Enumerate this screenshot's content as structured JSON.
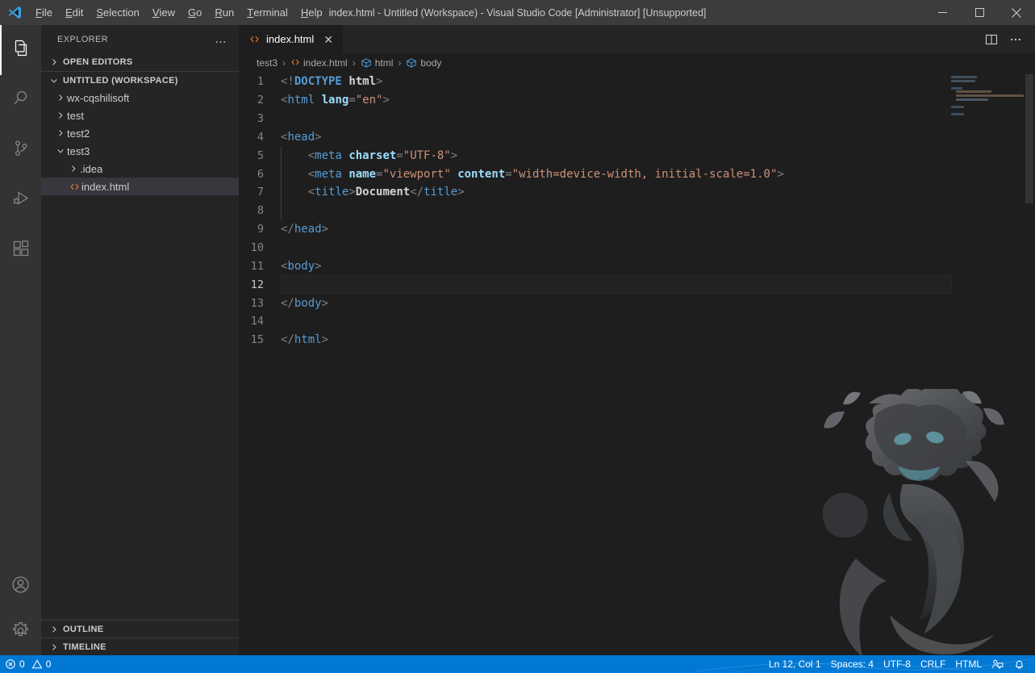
{
  "titlebar": {
    "window_title": "index.html - Untitled (Workspace) - Visual Studio Code [Administrator] [Unsupported]",
    "menus": [
      {
        "label": "File",
        "mnemonic": "F"
      },
      {
        "label": "Edit",
        "mnemonic": "E"
      },
      {
        "label": "Selection",
        "mnemonic": "S"
      },
      {
        "label": "View",
        "mnemonic": "V"
      },
      {
        "label": "Go",
        "mnemonic": "G"
      },
      {
        "label": "Run",
        "mnemonic": "R"
      },
      {
        "label": "Terminal",
        "mnemonic": "T"
      },
      {
        "label": "Help",
        "mnemonic": "H"
      }
    ],
    "window_controls": {
      "minimize": "minimize-icon",
      "maximize": "maximize-icon",
      "close": "close-icon"
    }
  },
  "activitybar": {
    "top_items": [
      {
        "name": "explorer",
        "icon": "files-icon",
        "active": true
      },
      {
        "name": "search",
        "icon": "search-icon",
        "active": false
      },
      {
        "name": "source-control",
        "icon": "source-control-icon",
        "active": false
      },
      {
        "name": "run-and-debug",
        "icon": "run-debug-icon",
        "active": false
      },
      {
        "name": "extensions",
        "icon": "extensions-icon",
        "active": false
      }
    ],
    "bottom_items": [
      {
        "name": "accounts",
        "icon": "account-icon"
      },
      {
        "name": "manage",
        "icon": "gear-icon"
      }
    ]
  },
  "sidebar": {
    "title": "EXPLORER",
    "more_actions": "…",
    "open_editors": {
      "label": "OPEN EDITORS",
      "expanded": false
    },
    "workspace": {
      "label": "UNTITLED (WORKSPACE)",
      "expanded": true
    },
    "tree": [
      {
        "label": "wx-cqshilisoft",
        "type": "folder",
        "depth": 1,
        "expanded": false,
        "selected": false
      },
      {
        "label": "test",
        "type": "folder",
        "depth": 1,
        "expanded": false,
        "selected": false
      },
      {
        "label": "test2",
        "type": "folder",
        "depth": 1,
        "expanded": false,
        "selected": false
      },
      {
        "label": "test3",
        "type": "folder",
        "depth": 1,
        "expanded": true,
        "selected": false
      },
      {
        "label": ".idea",
        "type": "folder",
        "depth": 2,
        "expanded": false,
        "selected": false
      },
      {
        "label": "index.html",
        "type": "html-file",
        "depth": 2,
        "expanded": false,
        "selected": true
      }
    ],
    "outline": {
      "label": "OUTLINE",
      "expanded": false
    },
    "timeline": {
      "label": "TIMELINE",
      "expanded": false
    }
  },
  "editor": {
    "tabs": [
      {
        "label": "index.html",
        "icon": "html-file-icon",
        "close": "✕",
        "active": true
      }
    ],
    "actions": [
      {
        "name": "split-editor",
        "icon": "split-editor-icon"
      },
      {
        "name": "more-actions",
        "icon": "ellipsis-icon"
      }
    ],
    "breadcrumbs": [
      {
        "label": "test3",
        "icon": ""
      },
      {
        "label": "index.html",
        "icon": "html-file-icon"
      },
      {
        "label": "html",
        "icon": "symbol-field-icon"
      },
      {
        "label": "body",
        "icon": "symbol-field-icon"
      }
    ],
    "breadcrumb_separator": "›",
    "lines": [
      {
        "n": "1",
        "tokens": [
          {
            "t": "punct",
            "v": "<!"
          },
          {
            "t": "doctype",
            "v": "DOCTYPE"
          },
          {
            "t": "text",
            "v": " "
          },
          {
            "t": "textb",
            "v": "html"
          },
          {
            "t": "punct",
            "v": ">"
          }
        ],
        "indent": 0,
        "active": false
      },
      {
        "n": "2",
        "tokens": [
          {
            "t": "punct",
            "v": "<"
          },
          {
            "t": "tag",
            "v": "html"
          },
          {
            "t": "text",
            "v": " "
          },
          {
            "t": "attr",
            "v": "lang"
          },
          {
            "t": "punct",
            "v": "="
          },
          {
            "t": "str",
            "v": "\"en\""
          },
          {
            "t": "punct",
            "v": ">"
          }
        ],
        "indent": 0,
        "active": false
      },
      {
        "n": "3",
        "tokens": [],
        "indent": 0,
        "active": false
      },
      {
        "n": "4",
        "tokens": [
          {
            "t": "punct",
            "v": "<"
          },
          {
            "t": "tag",
            "v": "head"
          },
          {
            "t": "punct",
            "v": ">"
          }
        ],
        "indent": 0,
        "active": false
      },
      {
        "n": "5",
        "tokens": [
          {
            "t": "text",
            "v": "    "
          },
          {
            "t": "punct",
            "v": "<"
          },
          {
            "t": "tag",
            "v": "meta"
          },
          {
            "t": "text",
            "v": " "
          },
          {
            "t": "attr",
            "v": "charset"
          },
          {
            "t": "punct",
            "v": "="
          },
          {
            "t": "str",
            "v": "\"UTF-8\""
          },
          {
            "t": "punct",
            "v": ">"
          }
        ],
        "indent": 1,
        "active": false
      },
      {
        "n": "6",
        "tokens": [
          {
            "t": "text",
            "v": "    "
          },
          {
            "t": "punct",
            "v": "<"
          },
          {
            "t": "tag",
            "v": "meta"
          },
          {
            "t": "text",
            "v": " "
          },
          {
            "t": "attr",
            "v": "name"
          },
          {
            "t": "punct",
            "v": "="
          },
          {
            "t": "str",
            "v": "\"viewport\""
          },
          {
            "t": "text",
            "v": " "
          },
          {
            "t": "attr",
            "v": "content"
          },
          {
            "t": "punct",
            "v": "="
          },
          {
            "t": "str",
            "v": "\"width=device-width, initial-scale=1.0\""
          },
          {
            "t": "punct",
            "v": ">"
          }
        ],
        "indent": 1,
        "active": false
      },
      {
        "n": "7",
        "tokens": [
          {
            "t": "text",
            "v": "    "
          },
          {
            "t": "punct",
            "v": "<"
          },
          {
            "t": "tag",
            "v": "title"
          },
          {
            "t": "punct",
            "v": ">"
          },
          {
            "t": "textb",
            "v": "Document"
          },
          {
            "t": "punct",
            "v": "</"
          },
          {
            "t": "tag",
            "v": "title"
          },
          {
            "t": "punct",
            "v": ">"
          }
        ],
        "indent": 1,
        "active": false
      },
      {
        "n": "8",
        "tokens": [],
        "indent": 1,
        "active": false
      },
      {
        "n": "9",
        "tokens": [
          {
            "t": "punct",
            "v": "</"
          },
          {
            "t": "tag",
            "v": "head"
          },
          {
            "t": "punct",
            "v": ">"
          }
        ],
        "indent": 0,
        "active": false
      },
      {
        "n": "10",
        "tokens": [],
        "indent": 0,
        "active": false
      },
      {
        "n": "11",
        "tokens": [
          {
            "t": "punct",
            "v": "<"
          },
          {
            "t": "tag",
            "v": "body"
          },
          {
            "t": "punct",
            "v": ">"
          }
        ],
        "indent": 0,
        "active": false
      },
      {
        "n": "12",
        "tokens": [],
        "indent": 0,
        "active": true
      },
      {
        "n": "13",
        "tokens": [
          {
            "t": "punct",
            "v": "</"
          },
          {
            "t": "tag",
            "v": "body"
          },
          {
            "t": "punct",
            "v": ">"
          }
        ],
        "indent": 0,
        "active": false
      },
      {
        "n": "14",
        "tokens": [],
        "indent": 0,
        "active": false
      },
      {
        "n": "15",
        "tokens": [
          {
            "t": "punct",
            "v": "</"
          },
          {
            "t": "tag",
            "v": "html"
          },
          {
            "t": "punct",
            "v": ">"
          }
        ],
        "indent": 0,
        "active": false
      }
    ]
  },
  "statusbar": {
    "errors": {
      "icon": "error-icon",
      "count": "0"
    },
    "warnings": {
      "icon": "warning-icon",
      "count": "0"
    },
    "cursor_position": "Ln 12, Col 1",
    "indentation": "Spaces: 4",
    "encoding": "UTF-8",
    "eol": "CRLF",
    "language": "HTML",
    "feedback_icon": "feedback-person-icon",
    "notifications_icon": "bell-icon"
  },
  "colors": {
    "accent": "#0078d4",
    "titlebar_bg": "#3c3c3c",
    "activitybar_bg": "#333333",
    "sidebar_bg": "#252526",
    "editor_bg": "#1e1e1e",
    "tag": "#569cd6",
    "attribute": "#9cdcfe",
    "string": "#ce9178",
    "punctuation": "#808080",
    "file_icon_html": "#e37933"
  }
}
